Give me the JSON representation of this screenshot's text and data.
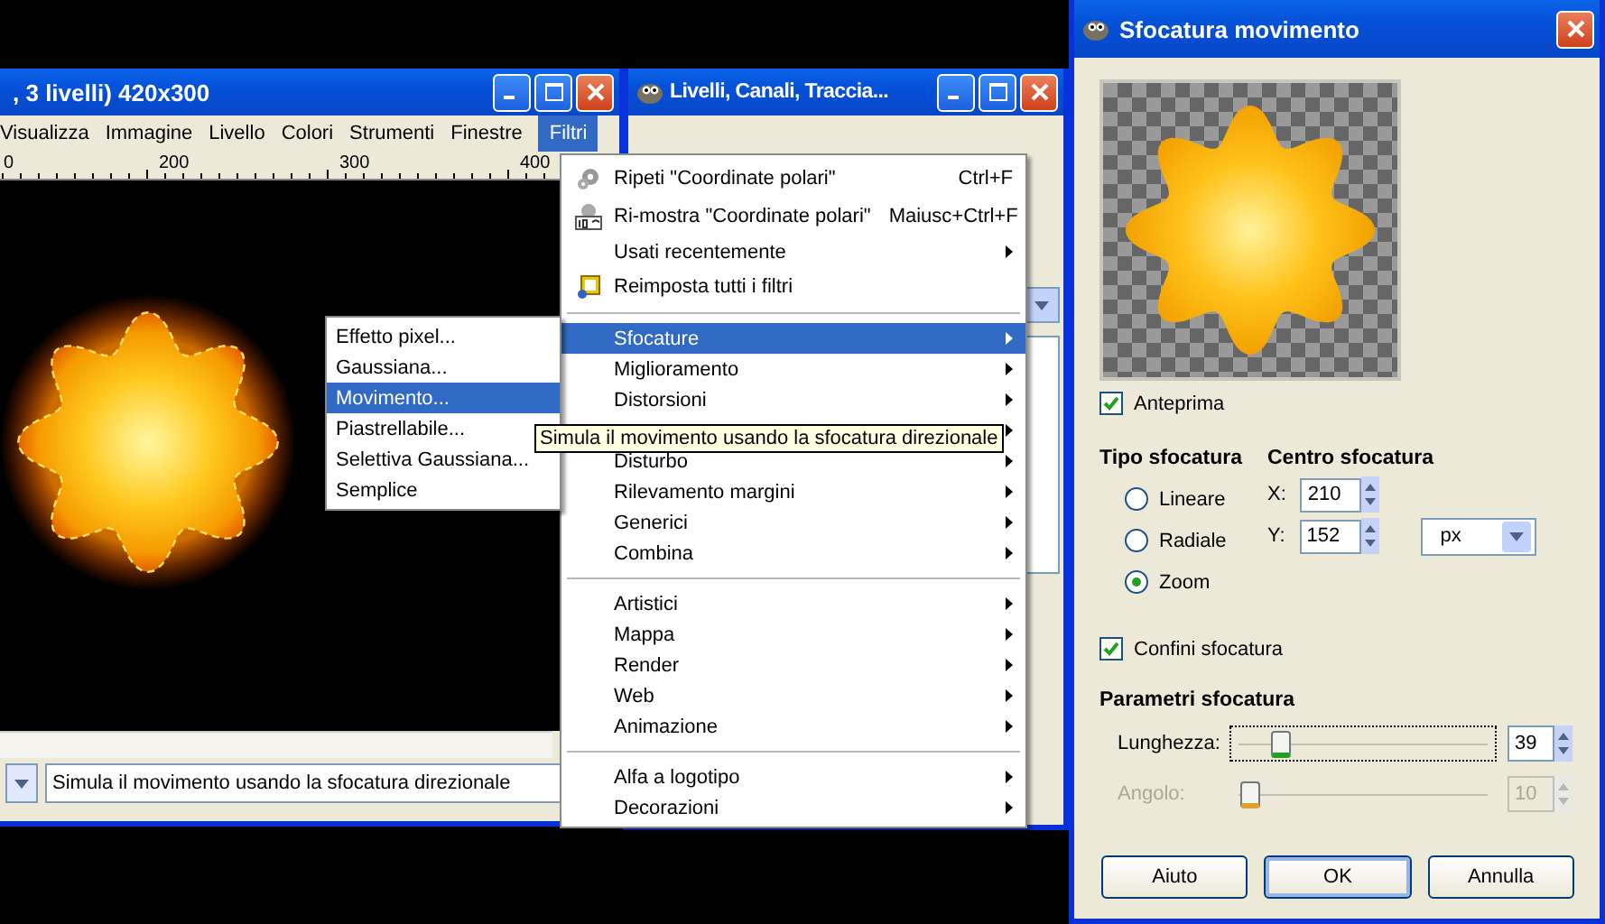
{
  "image_window": {
    "title": ", 3 livelli) 420x300",
    "menu": [
      {
        "label": "Visualizza",
        "selected": false
      },
      {
        "label": "Immagine",
        "selected": false
      },
      {
        "label": "Livello",
        "selected": false
      },
      {
        "label": "Colori",
        "selected": false
      },
      {
        "label": "Strumenti",
        "selected": false
      },
      {
        "label": "Finestre",
        "selected": false
      },
      {
        "label": "Filtri",
        "selected": true
      }
    ],
    "ruler": [
      "0",
      "200",
      "300",
      "400"
    ],
    "status": "Simula il movimento usando la sfocatura direzionale"
  },
  "layers_window": {
    "title": "Livelli, Canali, Traccia..."
  },
  "filters_menu": [
    {
      "kind": "command",
      "label": "Ripeti \"Coordinate polari\"",
      "shortcut": "Ctrl+F"
    },
    {
      "kind": "command",
      "label": "Ri-mostra \"Coordinate polari\"",
      "shortcut": "Maiusc+Ctrl+F"
    },
    {
      "kind": "submenu",
      "label": "Usati recentemente",
      "selected": false
    },
    {
      "kind": "command",
      "label": "Reimposta tutti i filtri"
    },
    {
      "kind": "separator"
    },
    {
      "kind": "submenu",
      "label": "Sfocature",
      "selected": true
    },
    {
      "kind": "submenu",
      "label": "Miglioramento",
      "selected": false
    },
    {
      "kind": "submenu",
      "label": "Distorsioni",
      "selected": false
    },
    {
      "kind": "covered"
    },
    {
      "kind": "submenu",
      "label": "Disturbo",
      "selected": false
    },
    {
      "kind": "submenu",
      "label": "Rilevamento margini",
      "selected": false
    },
    {
      "kind": "submenu",
      "label": "Generici",
      "selected": false
    },
    {
      "kind": "submenu",
      "label": "Combina",
      "selected": false
    },
    {
      "kind": "separator"
    },
    {
      "kind": "submenu",
      "label": "Artistici",
      "selected": false
    },
    {
      "kind": "submenu",
      "label": "Mappa",
      "selected": false
    },
    {
      "kind": "submenu",
      "label": "Render",
      "selected": false
    },
    {
      "kind": "submenu",
      "label": "Web",
      "selected": false
    },
    {
      "kind": "submenu",
      "label": "Animazione",
      "selected": false
    },
    {
      "kind": "separator"
    },
    {
      "kind": "submenu",
      "label": "Alfa a logotipo",
      "selected": false
    },
    {
      "kind": "submenu",
      "label": "Decorazioni",
      "selected": false
    }
  ],
  "blur_submenu": [
    {
      "label": "Effetto pixel...",
      "selected": false
    },
    {
      "label": "Gaussiana...",
      "selected": false
    },
    {
      "label": "Movimento...",
      "selected": true
    },
    {
      "label": "Piastrellabile...",
      "selected": false
    },
    {
      "label": "Selettiva Gaussiana...",
      "selected": false
    },
    {
      "label": "Semplice",
      "selected": false
    }
  ],
  "tooltip": "Simula il movimento usando la sfocatura direzionale",
  "dialog": {
    "title": "Sfocatura movimento",
    "preview": {
      "label": "Anteprima",
      "checked": true
    },
    "type_heading": "Tipo sfocatura",
    "types": [
      {
        "label": "Lineare",
        "selected": false
      },
      {
        "label": "Radiale",
        "selected": false
      },
      {
        "label": "Zoom",
        "selected": true
      }
    ],
    "center_heading": "Centro sfocatura",
    "center": [
      {
        "label": "X:",
        "value": "210"
      },
      {
        "label": "Y:",
        "value": "152"
      }
    ],
    "unit": "px",
    "clip": {
      "label": "Confini sfocatura",
      "checked": true
    },
    "params_heading": "Parametri sfocatura",
    "params": [
      {
        "label": "Lunghezza:",
        "level": 0.16,
        "value": "39",
        "disabled": false
      },
      {
        "label": "Angolo:",
        "level": 0.04,
        "value": "10",
        "disabled": true
      }
    ],
    "buttons": [
      {
        "label": "Aiuto",
        "default": false
      },
      {
        "label": "OK",
        "default": true
      },
      {
        "label": "Annulla",
        "default": false
      }
    ]
  }
}
